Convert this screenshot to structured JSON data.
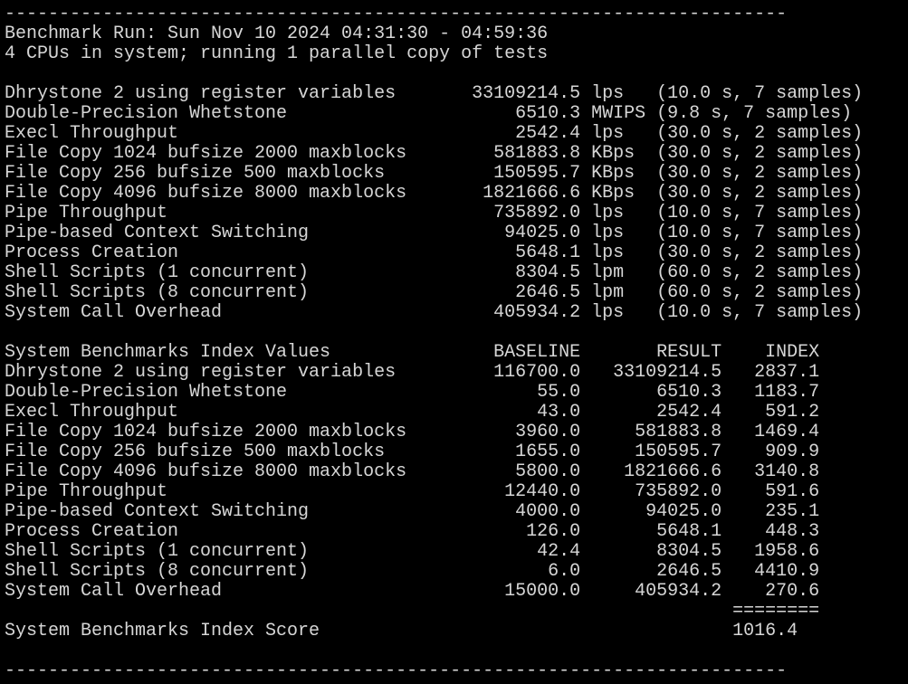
{
  "theme": {
    "background": "#000000",
    "foreground": "#d6d6d6"
  },
  "lines": [
    "------------------------------------------------------------------------",
    "Benchmark Run: Sun Nov 10 2024 04:31:30 - 04:59:36",
    "4 CPUs in system; running 1 parallel copy of tests",
    "",
    "Dhrystone 2 using register variables       33109214.5 lps   (10.0 s, 7 samples)",
    "Double-Precision Whetstone                     6510.3 MWIPS (9.8 s, 7 samples)",
    "Execl Throughput                               2542.4 lps   (30.0 s, 2 samples)",
    "File Copy 1024 bufsize 2000 maxblocks        581883.8 KBps  (30.0 s, 2 samples)",
    "File Copy 256 bufsize 500 maxblocks          150595.7 KBps  (30.0 s, 2 samples)",
    "File Copy 4096 bufsize 8000 maxblocks       1821666.6 KBps  (30.0 s, 2 samples)",
    "Pipe Throughput                              735892.0 lps   (10.0 s, 7 samples)",
    "Pipe-based Context Switching                  94025.0 lps   (10.0 s, 7 samples)",
    "Process Creation                               5648.1 lps   (30.0 s, 2 samples)",
    "Shell Scripts (1 concurrent)                   8304.5 lpm   (60.0 s, 2 samples)",
    "Shell Scripts (8 concurrent)                   2646.5 lpm   (60.0 s, 2 samples)",
    "System Call Overhead                         405934.2 lps   (10.0 s, 7 samples)",
    "",
    "System Benchmarks Index Values               BASELINE       RESULT    INDEX",
    "Dhrystone 2 using register variables         116700.0   33109214.5   2837.1",
    "Double-Precision Whetstone                       55.0       6510.3   1183.7",
    "Execl Throughput                                 43.0       2542.4    591.2",
    "File Copy 1024 bufsize 2000 maxblocks          3960.0     581883.8   1469.4",
    "File Copy 256 bufsize 500 maxblocks            1655.0     150595.7    909.9",
    "File Copy 4096 bufsize 8000 maxblocks          5800.0    1821666.6   3140.8",
    "Pipe Throughput                               12440.0     735892.0    591.6",
    "Pipe-based Context Switching                   4000.0      94025.0    235.1",
    "Process Creation                                126.0       5648.1    448.3",
    "Shell Scripts (1 concurrent)                     42.4       8304.5   1958.6",
    "Shell Scripts (8 concurrent)                      6.0       2646.5   4410.9",
    "System Call Overhead                          15000.0     405934.2    270.6",
    "                                                                   ========",
    "System Benchmarks Index Score                                      1016.4",
    "",
    "------------------------------------------------------------------------"
  ]
}
